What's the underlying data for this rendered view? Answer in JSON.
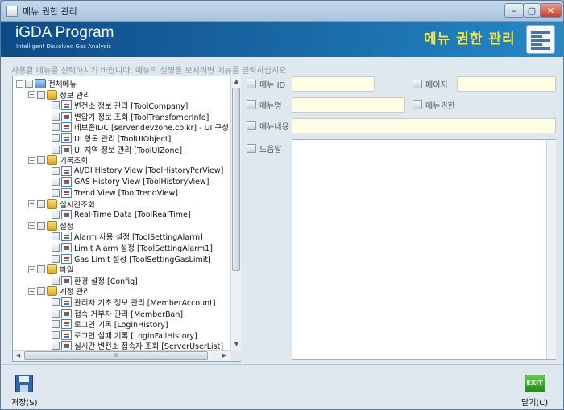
{
  "window": {
    "title": "메뉴 권한 관리",
    "min": "–",
    "max": "▢",
    "close": "✕"
  },
  "banner": {
    "brand": "iGDA Program",
    "subtitle": "Intelligent Dissolved Gas Analysis",
    "title": "메뉴 권한 관리",
    "icon": "list-document-icon"
  },
  "hint": "사용할 메뉴를 선택하시기 바랍니다. 메뉴의 설명을 보시려면 메뉴를 클릭하십시요",
  "tree": [
    {
      "label": "전체메뉴",
      "type": "root",
      "expander": "−"
    },
    {
      "label": "정보 관리",
      "type": "folder",
      "expander": "−"
    },
    {
      "label": "변전소 정보 관리 [ToolCompany]",
      "type": "item"
    },
    {
      "label": "변압기 정보 조회 [ToolTransfomerInfo]",
      "type": "item"
    },
    {
      "label": "데브존IDC [server.devzone.co.kr] - UI 구성 ? [ToolL",
      "type": "item"
    },
    {
      "label": "UI 항목 관리 [ToolUIObject]",
      "type": "item"
    },
    {
      "label": "UI 지역 정보 관리 [ToolUIZone]",
      "type": "item"
    },
    {
      "label": "기록조회",
      "type": "folder",
      "expander": "−"
    },
    {
      "label": "AI/DI History View [ToolHistoryPerView]",
      "type": "item"
    },
    {
      "label": "GAS History View [ToolHistoryView]",
      "type": "item"
    },
    {
      "label": "Trend View [ToolTrendView]",
      "type": "item"
    },
    {
      "label": "실시간조회",
      "type": "folder",
      "expander": "−"
    },
    {
      "label": "Real-Time Data [ToolRealTime]",
      "type": "item"
    },
    {
      "label": "설정",
      "type": "folder",
      "expander": "−"
    },
    {
      "label": "Alarm 사용 설정 [ToolSettingAlarm]",
      "type": "item"
    },
    {
      "label": "Limit Alarm 설정 [ToolSettingAlarm1]",
      "type": "item"
    },
    {
      "label": "Gas Limit 설정 [ToolSettingGasLimit]",
      "type": "item"
    },
    {
      "label": "파일",
      "type": "folder",
      "expander": "−"
    },
    {
      "label": "환경 설정 [Config]",
      "type": "item"
    },
    {
      "label": "계정 관리",
      "type": "folder",
      "expander": "−"
    },
    {
      "label": "관리자 기초 정보 관리 [MemberAccount]",
      "type": "item"
    },
    {
      "label": "접속 거부자 관리 [MemberBan]",
      "type": "item"
    },
    {
      "label": "로그인 기록 [LoginHistory]",
      "type": "item"
    },
    {
      "label": "로그인 실패 기록 [LoginFailHistory]",
      "type": "item"
    },
    {
      "label": "실시간 변전소 접속자 조회 [ServerUserList]",
      "type": "item"
    }
  ],
  "scroll": {
    "up": "▲",
    "down": "▼",
    "left": "◀",
    "right": "▶",
    "grip": "III"
  },
  "form": {
    "menu_id": {
      "label": "메뉴 ID",
      "value": ""
    },
    "page": {
      "label": "페이지",
      "value": ""
    },
    "menu_name": {
      "label": "메뉴명",
      "value": ""
    },
    "menu_perm": {
      "label": "메뉴권한"
    },
    "menu_content": {
      "label": "메뉴내용",
      "value": ""
    },
    "help": {
      "label": "도움말",
      "value": ""
    }
  },
  "footer": {
    "save": "저장(S)",
    "exit_badge": "EXIT",
    "close": "닫기(C)"
  }
}
